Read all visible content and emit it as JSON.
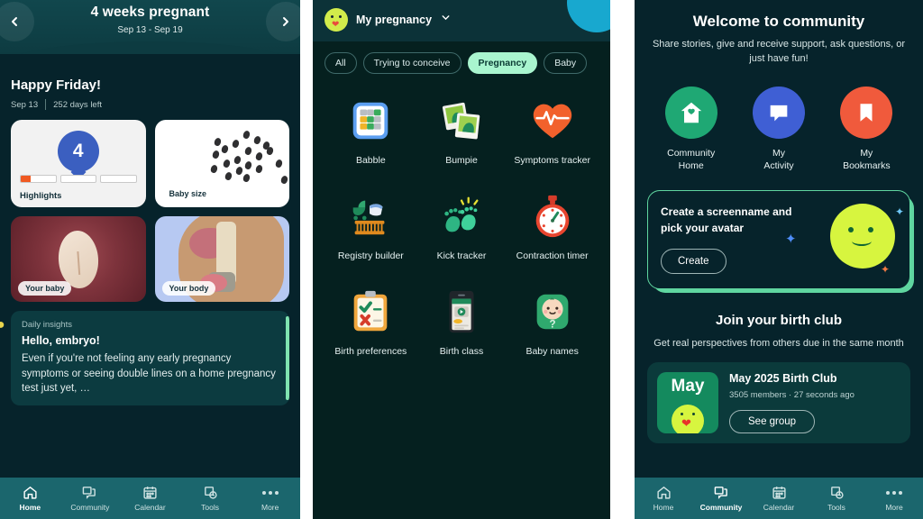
{
  "panel1": {
    "header": {
      "title": "4 weeks pregnant",
      "date_range": "Sep 13 - Sep 19",
      "prev_icon": "chevron-left-icon",
      "next_icon": "chevron-right-icon"
    },
    "greeting": {
      "title": "Happy Friday!",
      "date": "Sep 13",
      "days_left": "252 days left"
    },
    "cards": {
      "highlights": {
        "label": "Highlights",
        "week_number": "4",
        "progress_segments": 3,
        "filled_fraction": 0.28
      },
      "baby_size": {
        "label": "Baby size"
      },
      "your_baby": {
        "label": "Your baby"
      },
      "your_body": {
        "label": "Your body"
      }
    },
    "insight": {
      "kicker": "Daily insights",
      "title": "Hello, embryo!",
      "body": "Even if you're not feeling any early pregnancy symptoms or seeing double lines on a home pregnancy test just yet, …"
    },
    "nav": [
      {
        "label": "Home",
        "icon": "home-icon",
        "active": true
      },
      {
        "label": "Community",
        "icon": "community-icon",
        "active": false
      },
      {
        "label": "Calendar",
        "icon": "calendar-icon",
        "active": false
      },
      {
        "label": "Tools",
        "icon": "tools-icon",
        "active": false
      },
      {
        "label": "More",
        "icon": "more-dots-icon",
        "active": false
      }
    ]
  },
  "panel2": {
    "header": {
      "title": "My pregnancy",
      "avatar": "green-blob-avatar",
      "chevron": "chevron-down-icon"
    },
    "chips": [
      {
        "label": "All",
        "active": false
      },
      {
        "label": "Trying to conceive",
        "active": false
      },
      {
        "label": "Pregnancy",
        "active": true
      },
      {
        "label": "Baby",
        "active": false
      }
    ],
    "tools": [
      {
        "label": "Babble",
        "icon": "babble-grid-icon"
      },
      {
        "label": "Bumpie",
        "icon": "bumpie-photos-icon"
      },
      {
        "label": "Symptoms tracker",
        "icon": "heart-pulse-icon"
      },
      {
        "label": "Registry builder",
        "icon": "crib-stroller-icon"
      },
      {
        "label": "Kick tracker",
        "icon": "baby-feet-icon"
      },
      {
        "label": "Contraction timer",
        "icon": "stopwatch-icon"
      },
      {
        "label": "Birth preferences",
        "icon": "clipboard-check-icon"
      },
      {
        "label": "Birth class",
        "icon": "phone-video-icon"
      },
      {
        "label": "Baby names",
        "icon": "baby-face-icon"
      }
    ]
  },
  "panel3": {
    "title": "Welcome to community",
    "subtitle": "Share stories, give and receive support, ask questions, or just have fun!",
    "quick_actions": [
      {
        "label": "Community\nHome",
        "label_line1": "Community",
        "label_line2": "Home",
        "icon": "house-heart-icon",
        "color": "#1fa874"
      },
      {
        "label": "My Activity",
        "label_line1": "My",
        "label_line2": "Activity",
        "icon": "chat-bubble-icon",
        "color": "#3f5fd4"
      },
      {
        "label": "My Bookmarks",
        "label_line1": "My",
        "label_line2": "Bookmarks",
        "icon": "bookmark-icon",
        "color": "#f05a3c"
      }
    ],
    "create_card": {
      "text": "Create a screenname and pick your avatar",
      "button": "Create",
      "accent": "#5fd6a0"
    },
    "birth_club": {
      "title": "Join your birth club",
      "subtitle": "Get real perspectives from others due in the same month",
      "badge_month": "May",
      "name": "May 2025 Birth Club",
      "meta": "3505 members · 27 seconds ago",
      "button": "See group"
    },
    "nav": [
      {
        "label": "Home",
        "icon": "home-icon",
        "active": false
      },
      {
        "label": "Community",
        "icon": "community-icon",
        "active": true
      },
      {
        "label": "Calendar",
        "icon": "calendar-icon",
        "active": false
      },
      {
        "label": "Tools",
        "icon": "tools-icon",
        "active": false
      },
      {
        "label": "More",
        "icon": "more-dots-icon",
        "active": false
      }
    ]
  }
}
